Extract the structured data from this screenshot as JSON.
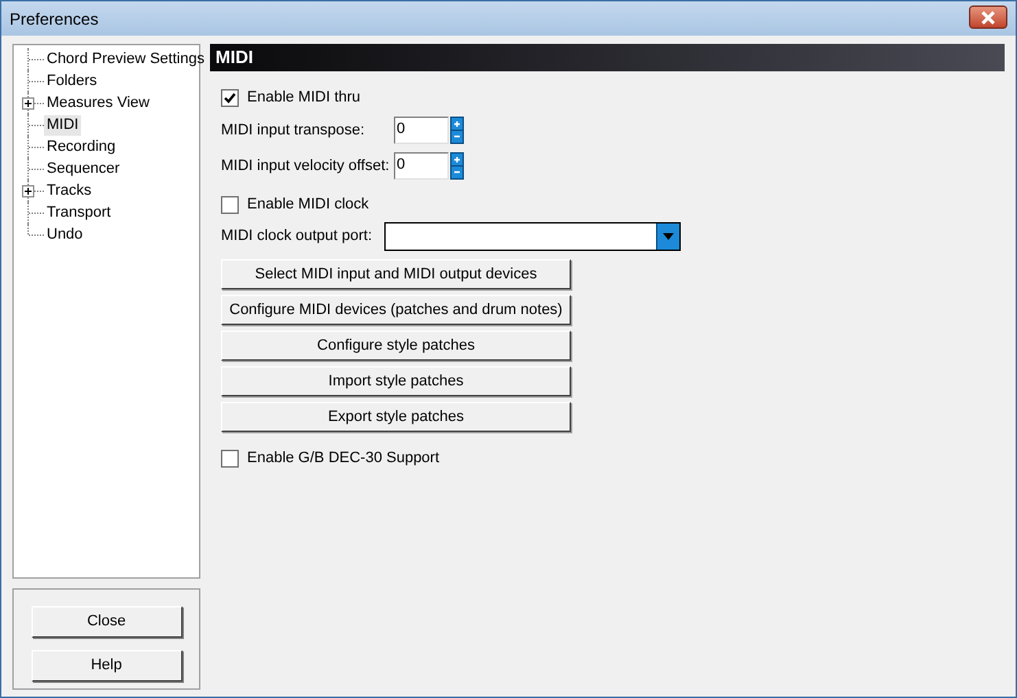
{
  "window": {
    "title": "Preferences"
  },
  "tree": [
    {
      "label": "Chord Preview Settings",
      "selected": false
    },
    {
      "label": "Folders",
      "selected": false
    },
    {
      "label": "Measures View",
      "selected": false,
      "expanded": false
    },
    {
      "label": "MIDI",
      "selected": true
    },
    {
      "label": "Recording",
      "selected": false
    },
    {
      "label": "Sequencer",
      "selected": false
    },
    {
      "label": "Tracks",
      "selected": false,
      "expanded": false
    },
    {
      "label": "Transport",
      "selected": false
    },
    {
      "label": "Undo",
      "selected": false
    }
  ],
  "footer_buttons": [
    "Close",
    "Help"
  ],
  "panel": {
    "title": "MIDI",
    "controls": [
      {
        "kind": "checkbox",
        "label": "Enable MIDI thru",
        "checked": true
      },
      {
        "kind": "spin",
        "label": "MIDI input transpose:",
        "value": "0"
      },
      {
        "kind": "spin",
        "label": "MIDI input velocity offset:",
        "value": "0"
      },
      {
        "kind": "checkbox",
        "label": "Enable MIDI clock",
        "checked": false
      },
      {
        "kind": "dropdown",
        "label": "MIDI clock output port:"
      },
      {
        "kind": "button",
        "label": "Select MIDI input and MIDI output devices"
      },
      {
        "kind": "button",
        "label": "Configure MIDI devices (patches and drum notes)"
      },
      {
        "kind": "button",
        "label": "Configure style patches"
      },
      {
        "kind": "button",
        "label": "Import style patches"
      },
      {
        "kind": "button",
        "label": "Export style patches"
      },
      {
        "kind": "checkbox",
        "label": "Enable G/B DEC-30 Support",
        "checked": false
      }
    ]
  }
}
